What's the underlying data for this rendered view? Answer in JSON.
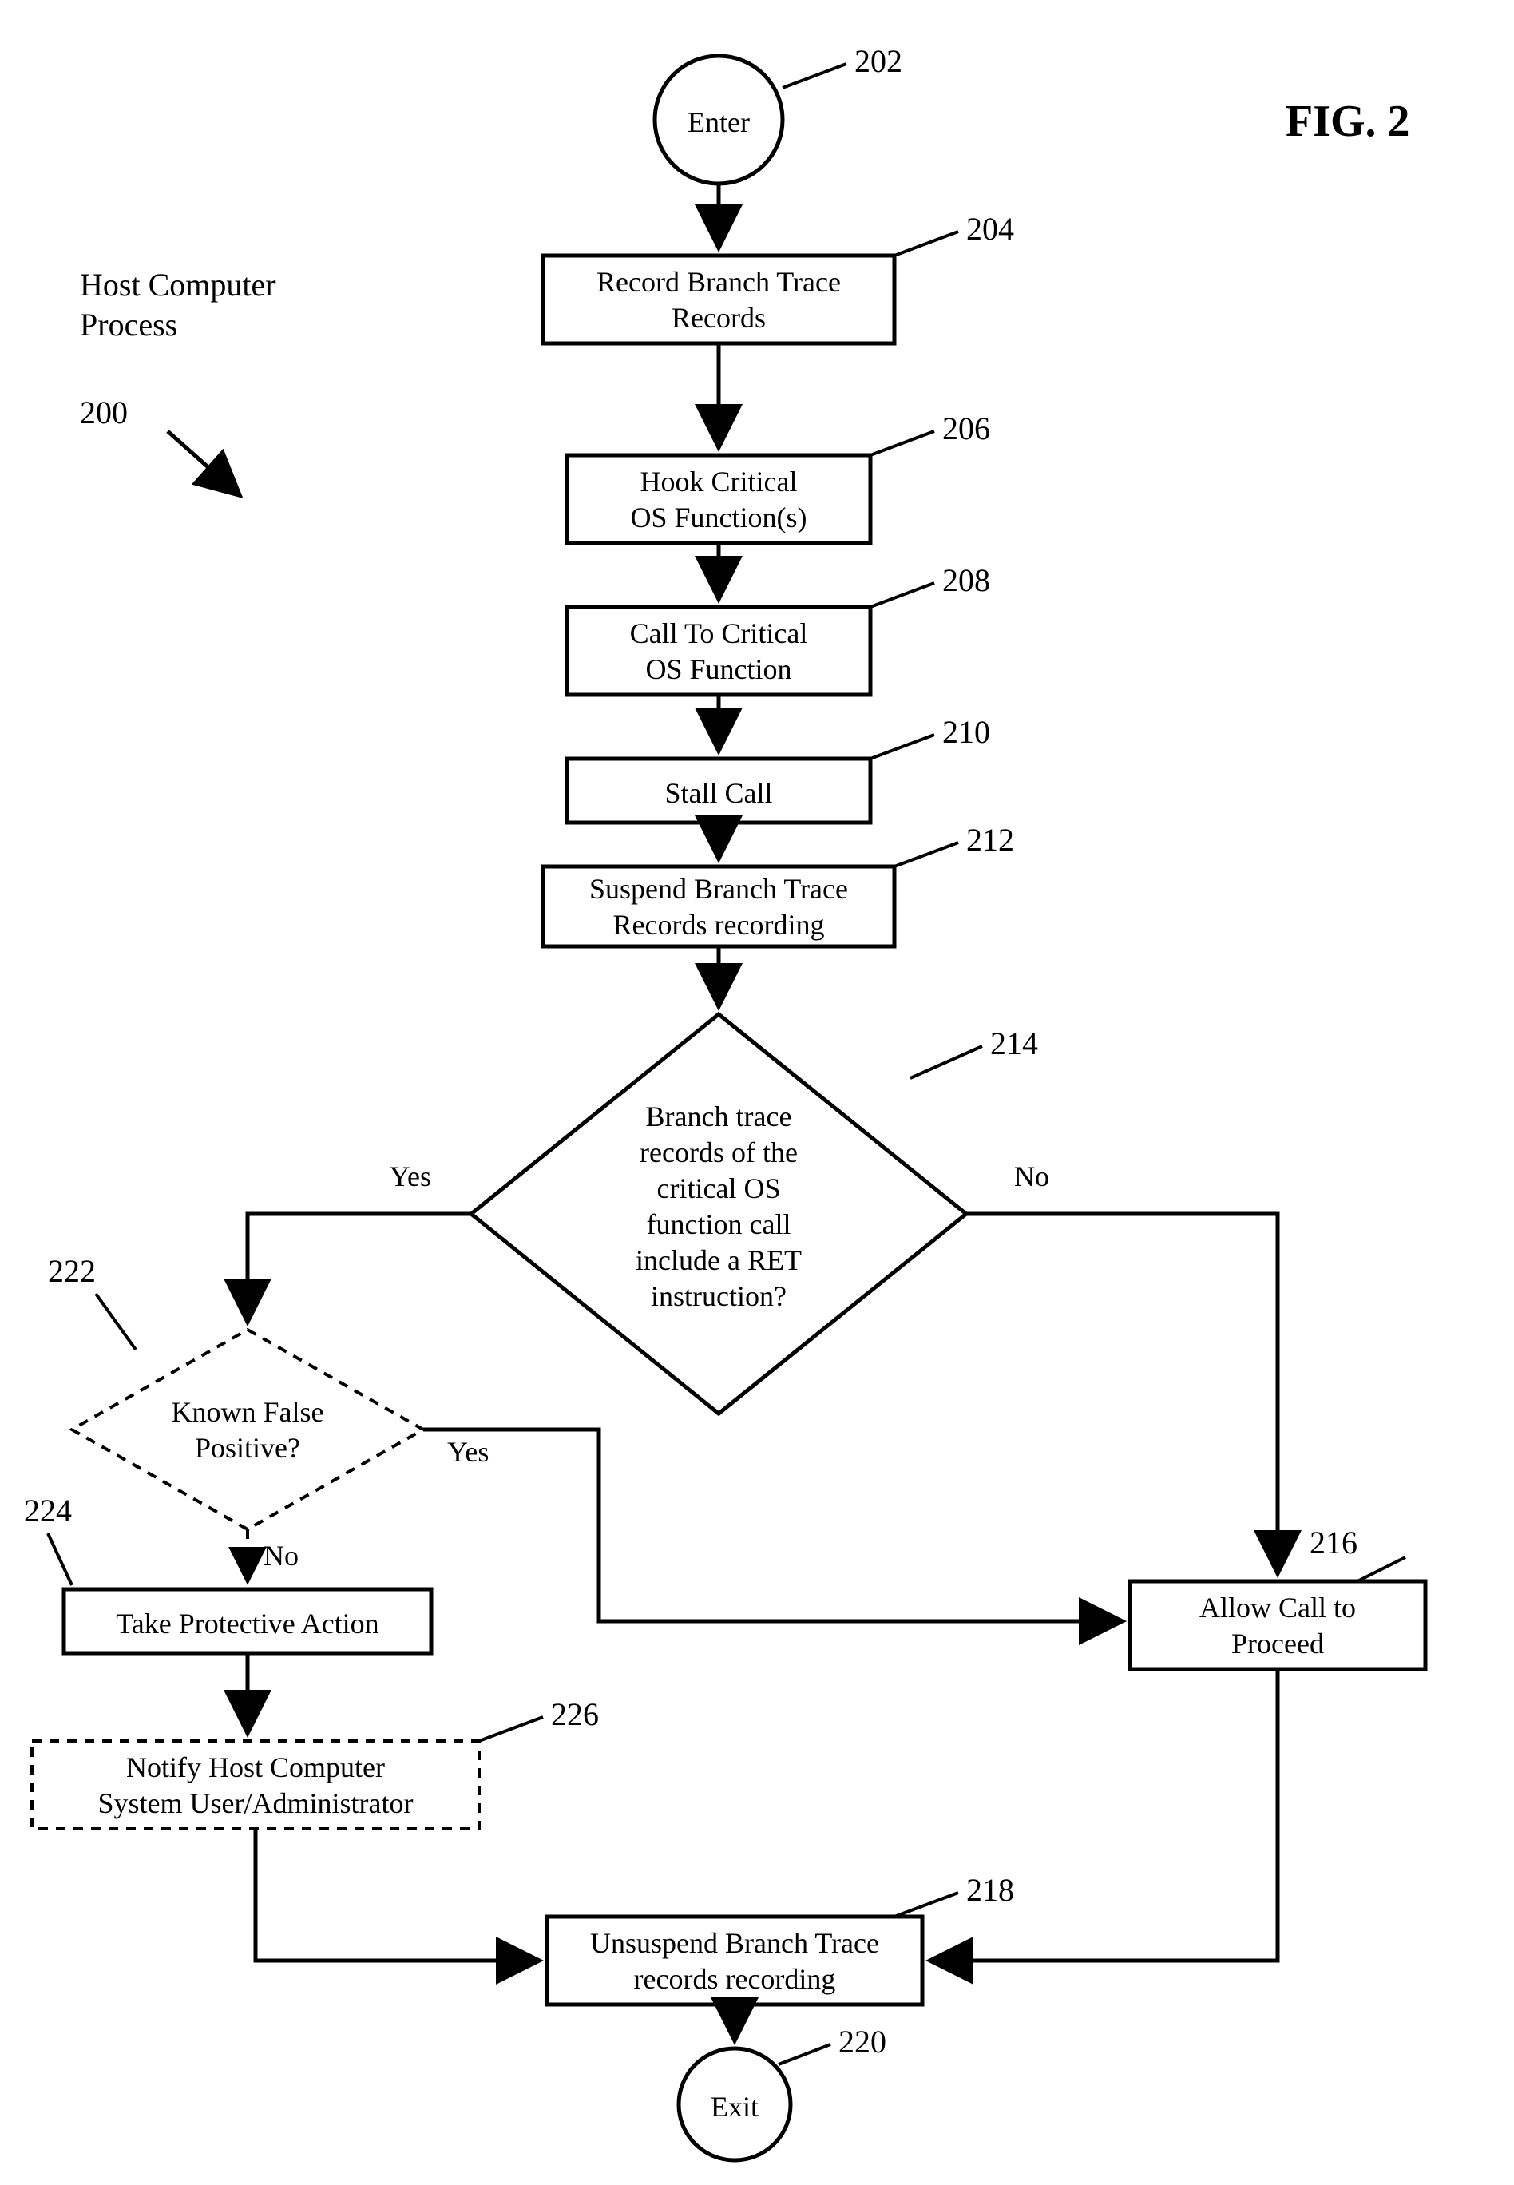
{
  "figureLabel": "FIG. 2",
  "processTitle1": "Host Computer",
  "processTitle2": "Process",
  "arrowRef": "200",
  "nodes": {
    "enter": {
      "ref": "202",
      "text": "Enter"
    },
    "record": {
      "ref": "204",
      "l1": "Record Branch Trace",
      "l2": "Records"
    },
    "hook": {
      "ref": "206",
      "l1": "Hook Critical",
      "l2": "OS Function(s)"
    },
    "call": {
      "ref": "208",
      "l1": "Call To Critical",
      "l2": "OS Function"
    },
    "stall": {
      "ref": "210",
      "l1": "Stall Call"
    },
    "suspend": {
      "ref": "212",
      "l1": "Suspend Branch Trace",
      "l2": "Records recording"
    },
    "decision": {
      "ref": "214",
      "l1": "Branch trace",
      "l2": "records of the",
      "l3": "critical OS",
      "l4": "function call",
      "l5": "include a RET",
      "l6": "instruction?"
    },
    "known": {
      "ref": "222",
      "l1": "Known False",
      "l2": "Positive?"
    },
    "protect": {
      "ref": "224",
      "l1": "Take Protective Action"
    },
    "notify": {
      "ref": "226",
      "l1": "Notify Host Computer",
      "l2": "System User/Administrator"
    },
    "allow": {
      "ref": "216",
      "l1": "Allow Call to",
      "l2": "Proceed"
    },
    "unsuspend": {
      "ref": "218",
      "l1": "Unsuspend Branch Trace",
      "l2": "records recording"
    },
    "exit": {
      "ref": "220",
      "text": "Exit"
    }
  },
  "edges": {
    "yes": "Yes",
    "no": "No"
  }
}
